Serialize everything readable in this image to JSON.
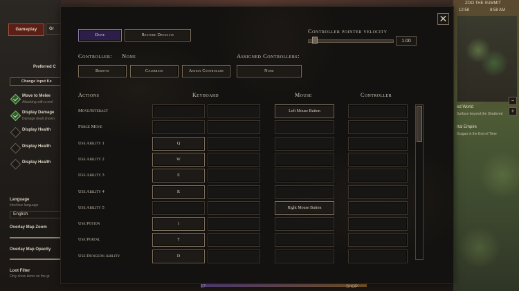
{
  "left_panel": {
    "tabs": [
      "Gameplay",
      "Gr"
    ],
    "preferred_label": "Preferred C",
    "change_input_button": "Change Input Ke",
    "options": [
      {
        "label": "Move to Melee",
        "sub": "Attacking with a mel",
        "checked": true
      },
      {
        "label": "Display Damage",
        "sub": "Damage dealt shown",
        "checked": true
      },
      {
        "label": "Display Health",
        "sub": "",
        "checked": false
      },
      {
        "label": "Display Health",
        "sub": "",
        "checked": false
      },
      {
        "label": "Display Health",
        "sub": "",
        "checked": false
      }
    ],
    "language_label": "Language",
    "language_sub": "Interface language",
    "language_value": "English",
    "overlay_zoom": "Overlay Map Zoom",
    "overlay_opacity": "Overlay Map Opacity",
    "loot_filter": "Loot Filter",
    "loot_filter_sub": "Only show items on the gr"
  },
  "right_hud": {
    "zone": "ZOO THE SUMMIT",
    "time": "8:58 AM",
    "time_left": "12:58",
    "world_title": "ed World",
    "world_sub": "Surface beyond the Shattered",
    "empire_title": "rtal Empire",
    "empire_sub": "Guigan in the End of Time",
    "minus_label": "−",
    "plus_label": "+"
  },
  "hud": {
    "level": "17",
    "shop": "SHOP"
  },
  "modal": {
    "close_symbol": "✕",
    "done_button": "Done",
    "restore_defaults_button": "Restore Defaults",
    "pointer_velocity_label": "Controller pointer velocity",
    "pointer_velocity_value": "1.00",
    "pointer_velocity_fraction": 0.05,
    "controller_label": "Controller:",
    "controller_value": "None",
    "assigned_controllers_label": "Assigned Controllers:",
    "remove_button": "Remove",
    "calibrate_button": "Calibrate",
    "assign_controller_button": "Assign Controller",
    "assigned_none_button": "None",
    "columns": {
      "actions": "Actions",
      "keyboard": "Keyboard",
      "mouse": "Mouse",
      "controller": "Controller"
    },
    "bindings": [
      {
        "action": "Move/Interact",
        "key1": "",
        "key2": "",
        "mouse": "Left Mouse Button",
        "controller": ""
      },
      {
        "action": "Force Move",
        "key1": "",
        "key2": "",
        "mouse": "",
        "controller": ""
      },
      {
        "action": "Use Ability 1",
        "key1": "Q",
        "key2": "",
        "mouse": "",
        "controller": ""
      },
      {
        "action": "Use Ability 2",
        "key1": "W",
        "key2": "",
        "mouse": "",
        "controller": ""
      },
      {
        "action": "Use Ability 3",
        "key1": "E",
        "key2": "",
        "mouse": "",
        "controller": ""
      },
      {
        "action": "Use Ability 4",
        "key1": "R",
        "key2": "",
        "mouse": "",
        "controller": ""
      },
      {
        "action": "Use Ability 5",
        "key1": "",
        "key2": "",
        "mouse": "Right Mouse Button",
        "controller": ""
      },
      {
        "action": "Use Potion",
        "key1": "1",
        "key2": "",
        "mouse": "",
        "controller": ""
      },
      {
        "action": "Use Portal",
        "key1": "T",
        "key2": "",
        "mouse": "",
        "controller": ""
      },
      {
        "action": "Use Dungeon Ability",
        "key1": "D",
        "key2": "",
        "mouse": "",
        "controller": ""
      }
    ]
  }
}
